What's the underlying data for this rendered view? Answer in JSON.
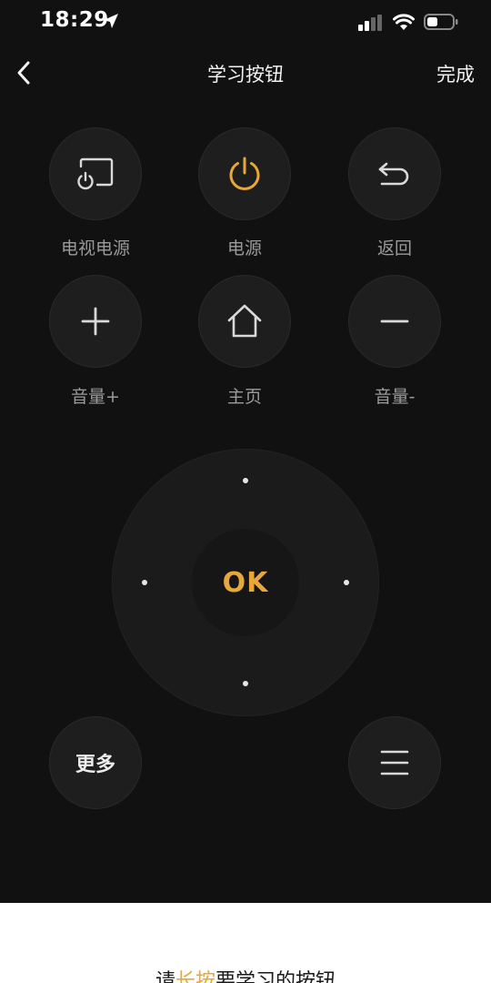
{
  "status_bar": {
    "time": "18:29"
  },
  "nav": {
    "title": "学习按钮",
    "done_label": "完成"
  },
  "buttons": {
    "tv_power": {
      "label": "电视电源"
    },
    "power": {
      "label": "电源"
    },
    "back": {
      "label": "返回"
    },
    "volume_up": {
      "label": "音量+"
    },
    "home": {
      "label": "主页"
    },
    "volume_down": {
      "label": "音量-"
    },
    "ok": {
      "label": "OK"
    },
    "more": {
      "label": "更多"
    }
  },
  "hint": {
    "prefix": "请",
    "highlight": "长按",
    "suffix": "要学习的按钮"
  },
  "colors": {
    "accent": "#e8a838",
    "background": "#111111",
    "button": "#1e1e1e"
  },
  "icons": [
    "location-arrow-icon",
    "signal-icon",
    "wifi-icon",
    "battery-icon",
    "chevron-left-icon",
    "tv-power-icon",
    "power-icon",
    "return-icon",
    "plus-icon",
    "home-icon",
    "minus-icon",
    "menu-icon"
  ]
}
